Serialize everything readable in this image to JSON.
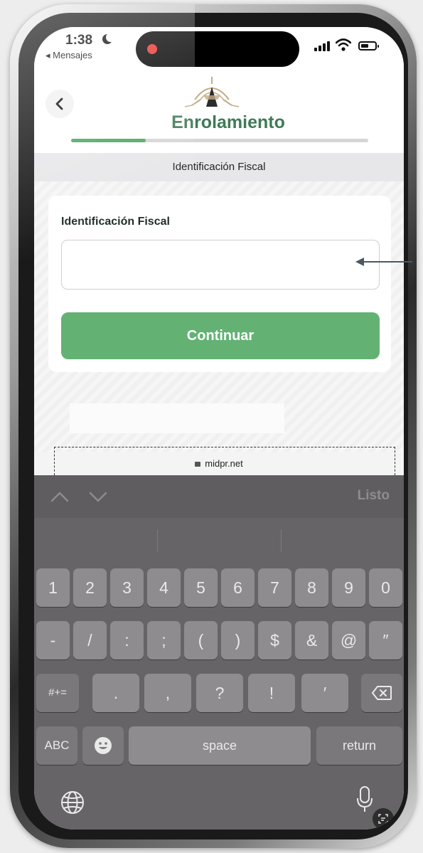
{
  "status_bar": {
    "time": "1:38",
    "back_app": "◂ Mensajes"
  },
  "header": {
    "title": "Enrolamiento",
    "progress_percent": 25
  },
  "step_banner": {
    "text": "Identificación Fiscal"
  },
  "form": {
    "label": "Identificación Fiscal",
    "input_value": "",
    "continue_label": "Continuar"
  },
  "browser": {
    "url": "midpr.net"
  },
  "keyboard": {
    "done_label": "Listo",
    "row1": [
      "1",
      "2",
      "3",
      "4",
      "5",
      "6",
      "7",
      "8",
      "9",
      "0"
    ],
    "row2": [
      "-",
      "/",
      ":",
      ";",
      "(",
      ")",
      "$",
      "&",
      "@",
      "″"
    ],
    "row3": [
      ".",
      ",",
      "?",
      "!",
      "′"
    ],
    "symbols_key": "#+=",
    "abc_key": "ABC",
    "space_key": "space",
    "return_key": "return"
  },
  "colors": {
    "brand_green": "#3f7a56",
    "button_green": "#63b274",
    "progress_green": "#4fa864"
  }
}
